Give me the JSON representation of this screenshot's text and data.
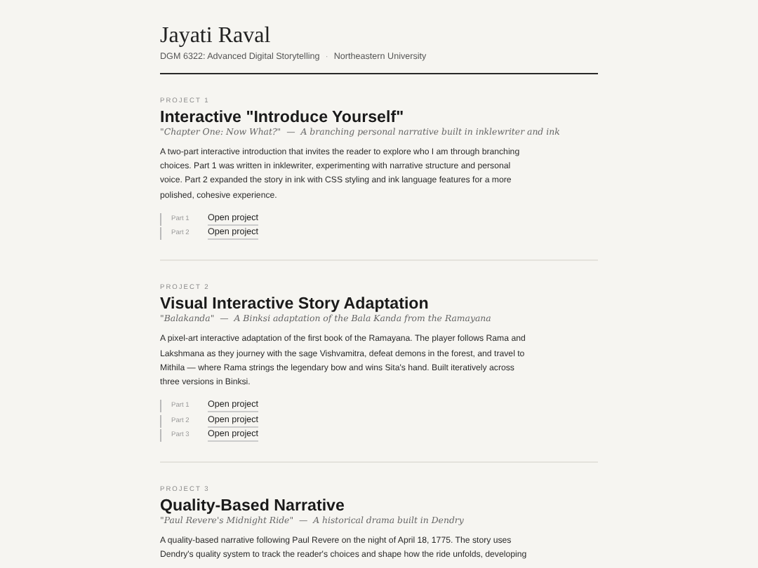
{
  "header": {
    "name": "Jayati Raval",
    "course": "DGM 6322: Advanced Digital Storytelling",
    "separator": "·",
    "school": "Northeastern University"
  },
  "projects": [
    {
      "label": "PROJECT 1",
      "title": "Interactive \"Introduce Yourself\"",
      "work": "\"Chapter One: Now What?\"",
      "dash": "—",
      "tagline": "A branching personal narrative built in inklewriter and ink",
      "description": "A two-part interactive introduction that invites the reader to explore who I am through branching choices. Part 1 was written in inklewriter, experimenting with narrative structure and personal voice. Part 2 expanded the story in ink with CSS styling and ink language features for a more polished, cohesive experience.",
      "links": [
        {
          "part": "Part 1",
          "text": "Open project"
        },
        {
          "part": "Part 2",
          "text": "Open project"
        }
      ]
    },
    {
      "label": "PROJECT 2",
      "title": "Visual Interactive Story Adaptation",
      "work": "\"Balakanda\"",
      "dash": "—",
      "tagline": "A Binksi adaptation of the Bala Kanda from the Ramayana",
      "description": "A pixel-art interactive adaptation of the first book of the Ramayana. The player follows Rama and Lakshmana as they journey with the sage Vishvamitra, defeat demons in the forest, and travel to Mithila — where Rama strings the legendary bow and wins Sita's hand. Built iteratively across three versions in Binksi.",
      "links": [
        {
          "part": "Part 1",
          "text": "Open project"
        },
        {
          "part": "Part 2",
          "text": "Open project"
        },
        {
          "part": "Part 3",
          "text": "Open project"
        }
      ]
    },
    {
      "label": "PROJECT 3",
      "title": "Quality-Based Narrative",
      "work": "\"Paul Revere's Midnight Ride\"",
      "dash": "—",
      "tagline": "A historical drama built in Dendry",
      "description": "A quality-based narrative following Paul Revere on the night of April 18, 1775. The story uses Dendry's quality system to track the reader's choices and shape how the ride unfolds, developing"
    }
  ]
}
